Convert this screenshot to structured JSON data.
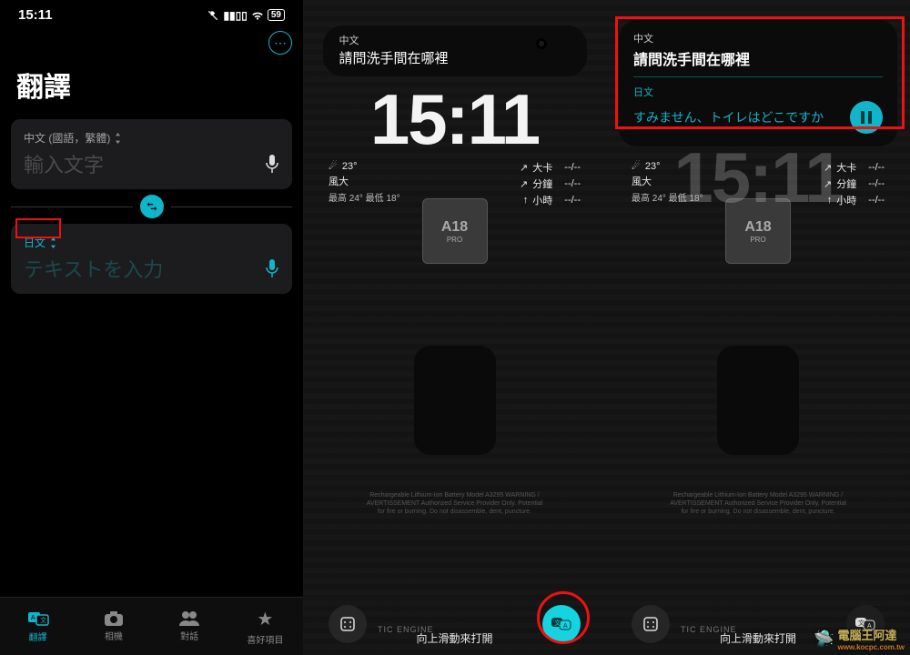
{
  "status": {
    "time": "15:11",
    "battery": "59"
  },
  "app": {
    "title": "翻譯",
    "source_lang_label": "中文 (國語，繁體)",
    "source_placeholder": "輸入文字",
    "target_lang_label": "日文",
    "target_placeholder": "テキストを入力",
    "tabs": [
      {
        "icon": "translate",
        "label": "翻譯"
      },
      {
        "icon": "camera",
        "label": "相機"
      },
      {
        "icon": "people",
        "label": "對話"
      },
      {
        "icon": "star",
        "label": "喜好項目"
      }
    ]
  },
  "lock": {
    "time": "15:11",
    "pill_lang": "中文",
    "pill_text": "請問洗手間在哪裡",
    "weather": {
      "temp": "23°",
      "wind": "風大",
      "hilo": "最高 24° 最低 18°"
    },
    "cal": {
      "r1a": "大卡",
      "r1b": "--/--",
      "r2a": "分鐘",
      "r2b": "--/--",
      "r3a": "小時",
      "r3b": "--/--"
    },
    "chip": "A18",
    "chip_sub": "PRO",
    "battery_text": "Rechargeable Lithium-Ion Battery Model A3295\nWARNING / AVERTISSEMENT Authorized Service Provider Only.\nPotential for fire or burning. Do not disassemble, dent, puncture.",
    "swipe": "向上滑動來打開",
    "engine": "TIC ENGINE"
  },
  "overlay": {
    "src_lang": "中文",
    "src_text": "請問洗手間在哪裡",
    "tgt_lang": "日文",
    "tgt_text": "すみません、トイレはどこですか"
  },
  "watermark": {
    "main": "電腦王阿達",
    "sub": "www.kocpc.com.tw"
  },
  "colors": {
    "teal": "#0fb5c9",
    "red": "#e11"
  }
}
